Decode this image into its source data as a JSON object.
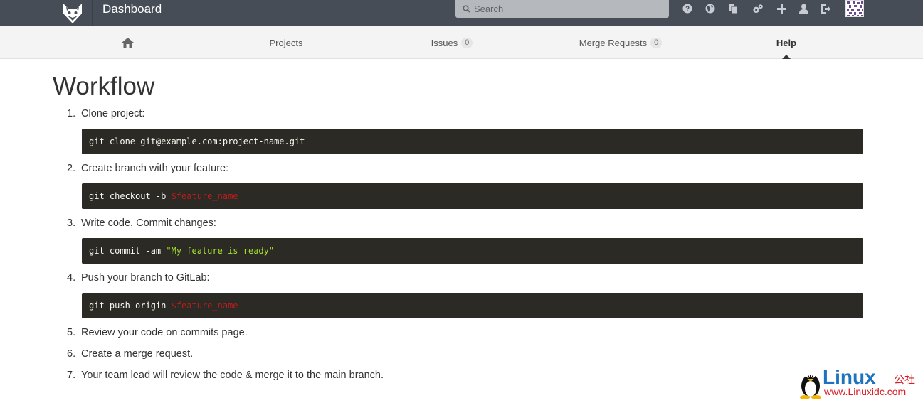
{
  "header": {
    "title": "Dashboard",
    "search_placeholder": "Search",
    "icons": [
      "help-icon",
      "globe-icon",
      "snippets-icon",
      "admin-icon",
      "plus-icon",
      "profile-icon",
      "logout-icon"
    ]
  },
  "nav": {
    "home_icon": "home-icon",
    "projects": "Projects",
    "issues": "Issues",
    "issues_count": "0",
    "merge_requests": "Merge Requests",
    "merge_requests_count": "0",
    "help": "Help"
  },
  "content": {
    "title": "Workflow",
    "steps": [
      {
        "num": "1.",
        "label": "Clone project:",
        "code": {
          "cmd": "git clone git@example.com:project-name.git",
          "var": "",
          "str": ""
        }
      },
      {
        "num": "2.",
        "label": "Create branch with your feature:",
        "code": {
          "cmd": "git checkout -b ",
          "var": "$feature_name",
          "str": ""
        }
      },
      {
        "num": "3.",
        "label": "Write code. Commit changes:",
        "code": {
          "cmd": "git commit -am ",
          "var": "",
          "str": "\"My feature is ready\""
        }
      },
      {
        "num": "4.",
        "label": "Push your branch to GitLab:",
        "code": {
          "cmd": "git push origin ",
          "var": "$feature_name",
          "str": ""
        }
      },
      {
        "num": "5.",
        "label": "Review your code on commits page."
      },
      {
        "num": "6.",
        "label": "Create a merge request."
      },
      {
        "num": "7.",
        "label": "Your team lead will review the code & merge it to the main branch."
      }
    ]
  },
  "watermark": {
    "brand": "Linux",
    "brand_suffix": "公社",
    "url": "www.Linuxidc.com"
  },
  "colors": {
    "header_bg": "#474d57",
    "nav_bg": "#f4f4f4",
    "code_bg": "#2b2a24",
    "code_var": "#b91d1d",
    "code_str": "#a6e22e",
    "watermark_blue": "#1e73be",
    "watermark_red": "#d61f26"
  }
}
